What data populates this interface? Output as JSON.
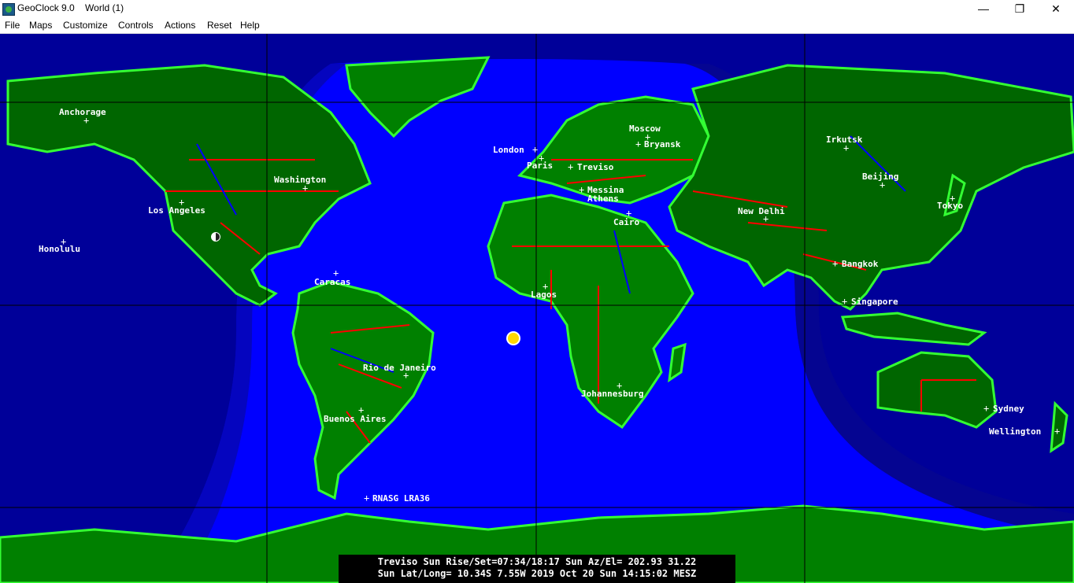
{
  "window": {
    "app_title": "GeoClock 9.0",
    "doc_title": "World  (1)",
    "minimize": "—",
    "maximize": "❐",
    "close": "✕"
  },
  "menu": {
    "items": [
      "File",
      "Maps",
      "Customize",
      "Controls",
      "Actions",
      "Reset",
      "Help"
    ]
  },
  "colors": {
    "ocean_day": "#0000ff",
    "ocean_night": "#000099",
    "land_day": "#008000",
    "land_night": "#004d00",
    "coast": "#33ff33",
    "borders": "#ff0000",
    "grid": "#000000",
    "labels": "#ffffff",
    "sun": "#ffd700"
  },
  "cities": {
    "anchorage": "Anchorage",
    "honolulu": "Honolulu",
    "los_angeles": "Los Angeles",
    "washington": "Washington",
    "caracas": "Caracas",
    "rio": "Rio de Janeiro",
    "buenos_aires": "Buenos Aires",
    "rnasg": "RNASG LRA36",
    "london": "London",
    "paris": "Paris",
    "treviso": "Treviso",
    "messina": "Messina",
    "athens": "Athens",
    "cairo": "Cairo",
    "lagos": "Lagos",
    "johannesburg": "Johannesburg",
    "moscow": "Moscow",
    "bryansk": "Bryansk",
    "new_delhi": "New Delhi",
    "irkutsk": "Irkutsk",
    "beijing": "Beijing",
    "tokyo": "Tokyo",
    "bangkok": "Bangkok",
    "singapore": "Singapore",
    "sydney": "Sydney",
    "wellington": "Wellington"
  },
  "status": {
    "line1": "Treviso Sun Rise/Set=07:34/18:17  Sun Az/El= 202.93  31.22",
    "line2": "Sun Lat/Long=  10.34S    7.55W   2019 Oct 20 Sun 14:15:02 MESZ"
  }
}
